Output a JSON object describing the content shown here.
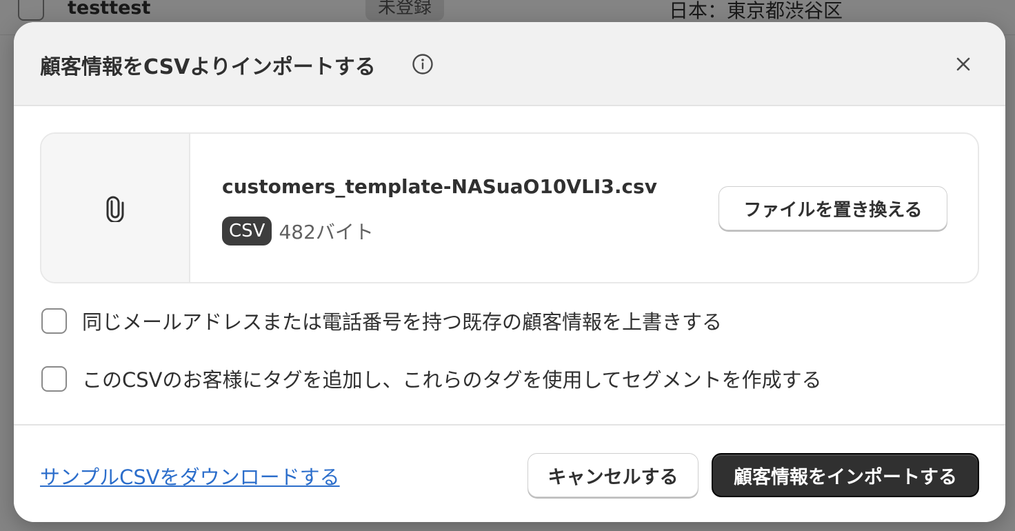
{
  "background": {
    "row_name": "testtest",
    "row_status": "未登録",
    "row_location": "日本：東京都渋谷区"
  },
  "modal": {
    "title": "顧客情報をCSVよりインポートする",
    "info_icon": "info-circle-icon",
    "close_icon": "close-icon",
    "file": {
      "icon": "paperclip-icon",
      "name": "customers_template-NASuaO10VLI3.csv",
      "type_badge": "CSV",
      "size": "482バイト",
      "replace_label": "ファイルを置き換える"
    },
    "options": [
      {
        "label": "同じメールアドレスまたは電話番号を持つ既存の顧客情報を上書きする",
        "checked": false
      },
      {
        "label": "このCSVのお客様にタグを追加し、これらのタグを使用してセグメントを作成する",
        "checked": false
      }
    ],
    "footer": {
      "sample_link": "サンプルCSVをダウンロードする",
      "cancel_label": "キャンセルする",
      "import_label": "顧客情報をインポートする"
    }
  },
  "colors": {
    "link": "#2c6ecb",
    "primary_button": "#303030",
    "badge": "#3d3d3d"
  }
}
